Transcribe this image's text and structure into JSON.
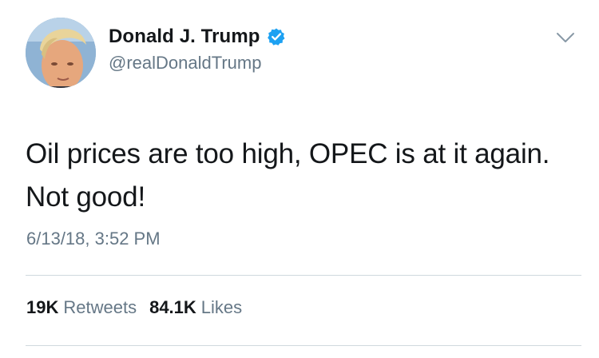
{
  "user": {
    "display_name": "Donald J. Trump",
    "handle": "@realDonaldTrump",
    "verified_icon": "verified-badge-icon",
    "avatar_icon": "avatar"
  },
  "tweet": {
    "text_line1": "Oil prices are too high, OPEC is at it again.",
    "text_line2": "Not good!",
    "timestamp": "6/13/18, 3:52 PM"
  },
  "stats": {
    "retweets_count": "19K",
    "retweets_label": "Retweets",
    "likes_count": "84.1K",
    "likes_label": "Likes"
  },
  "menu": {
    "icon": "chevron-down-icon"
  },
  "colors": {
    "text_primary": "#14171a",
    "text_secondary": "#657786",
    "verified_blue": "#1da1f2",
    "divider": "#cfd9de"
  }
}
